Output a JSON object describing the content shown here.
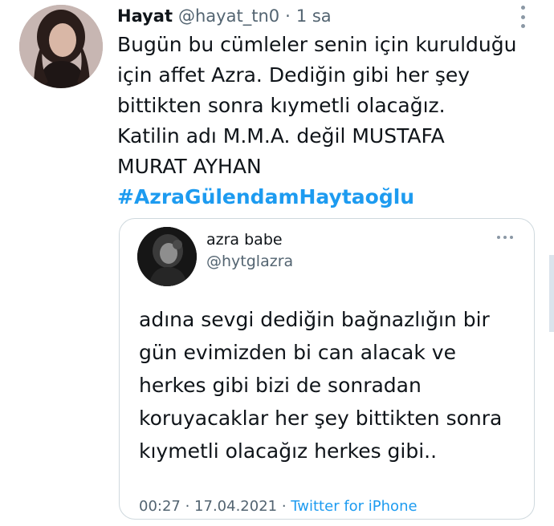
{
  "tweet": {
    "display_name": "Hayat",
    "handle": "@hayat_tn0",
    "separator": "·",
    "time": "1 sa",
    "text_lines": [
      "Bugün bu cümleler senin için kurulduğu",
      "için affet Azra. Dediğin gibi her şey",
      "bittikten sonra kıymetli olacağız.",
      "Katilin adı M.M.A. değil MUSTAFA",
      "MURAT AYHAN"
    ],
    "hashtag": "#AzraGülendamHaytaoğlu",
    "more_icon": "vertical-dots-icon"
  },
  "quoted_tweet": {
    "display_name": "azra babe",
    "handle": "@hytglazra",
    "more_icon": "horizontal-dots-icon",
    "text_lines": [
      "adına sevgi dediğin bağnazlığın bir",
      "gün evimizden bi can alacak ve",
      "herkes gibi bizi de sonradan",
      "koruyacaklar her şey bittikten sonra",
      "kıymetli olacağız herkes gibi.."
    ],
    "timestamp": "00:27 · 17.04.2021 · ",
    "source": "Twitter for iPhone"
  },
  "colors": {
    "accent": "#1d9bf0",
    "secondary_text": "#536471",
    "border": "#cfd9de"
  }
}
